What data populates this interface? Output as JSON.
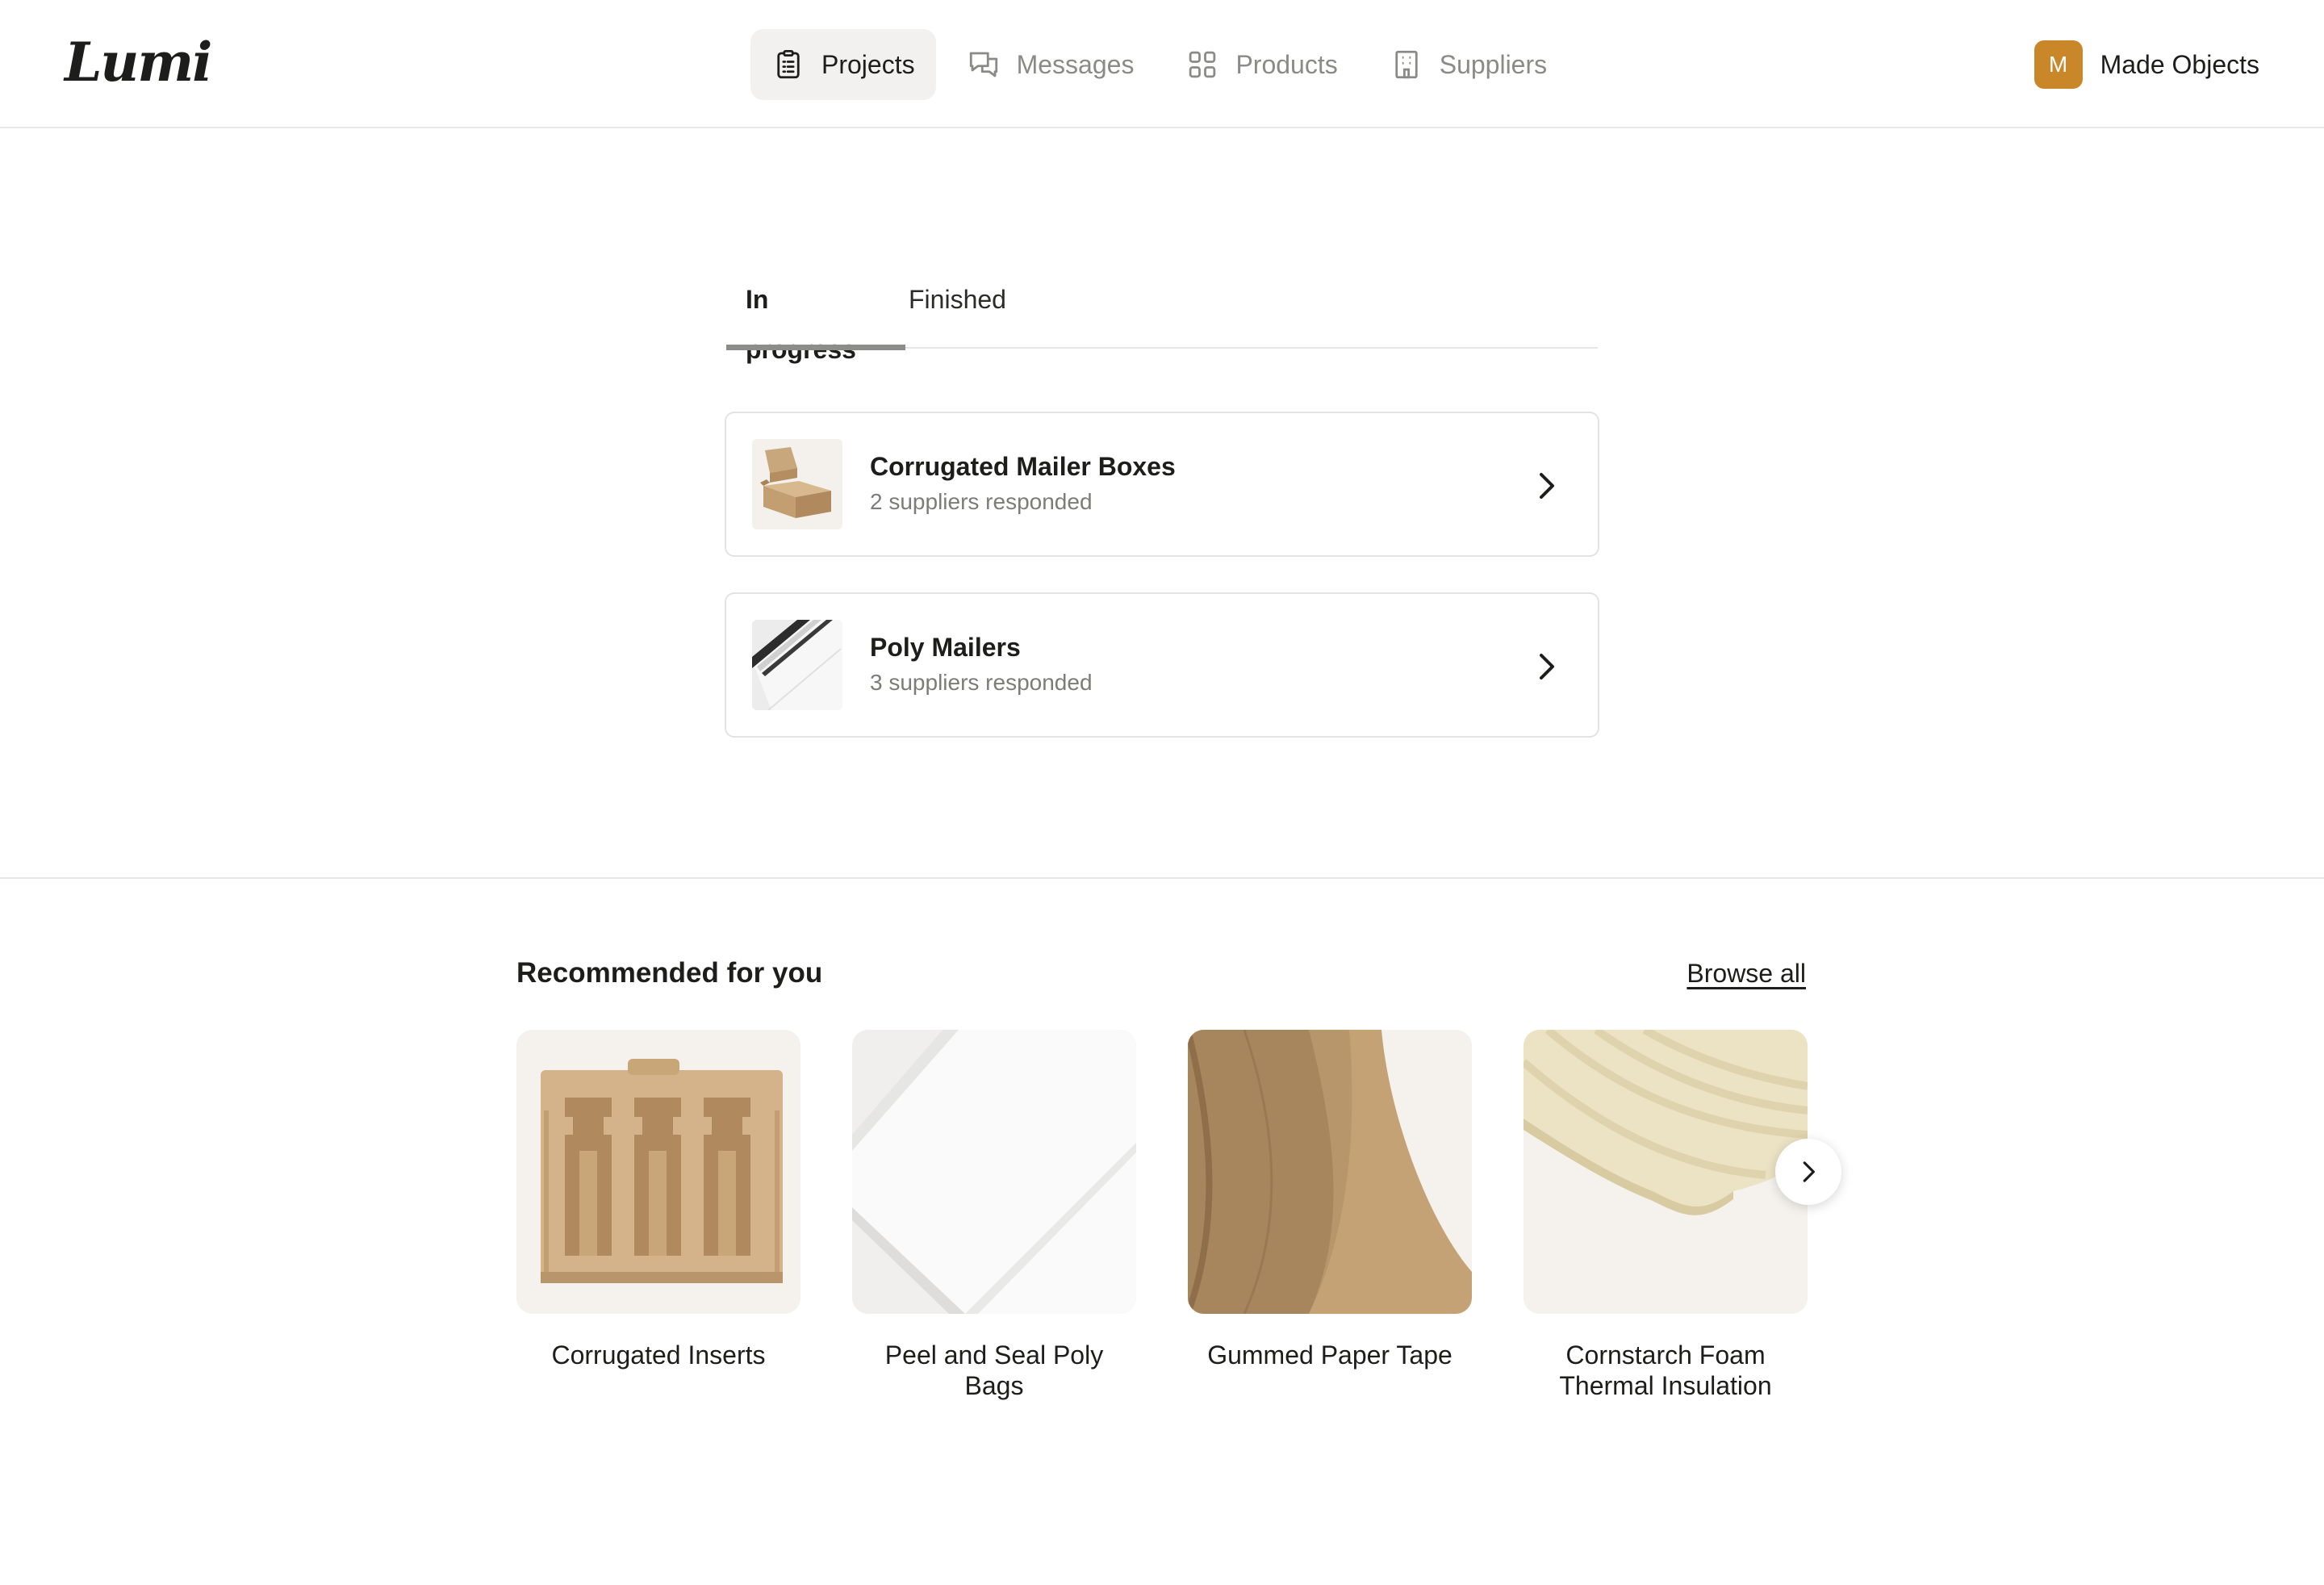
{
  "app": {
    "logo": "Lumi"
  },
  "nav": {
    "items": [
      {
        "label": "Projects",
        "icon": "clipboard-icon",
        "active": true
      },
      {
        "label": "Messages",
        "icon": "chat-icon",
        "active": false
      },
      {
        "label": "Products",
        "icon": "grid-icon",
        "active": false
      },
      {
        "label": "Suppliers",
        "icon": "building-icon",
        "active": false
      }
    ]
  },
  "account": {
    "initial": "M",
    "name": "Made Objects",
    "avatar_color": "#c9872a"
  },
  "tabs": [
    {
      "label": "In progress",
      "active": true
    },
    {
      "label": "Finished",
      "active": false
    }
  ],
  "projects": [
    {
      "title": "Corrugated Mailer Boxes",
      "subtitle": "2 suppliers responded",
      "thumb": "mailer-box"
    },
    {
      "title": "Poly Mailers",
      "subtitle": "3 suppliers responded",
      "thumb": "poly-mailer"
    }
  ],
  "recommended": {
    "title": "Recommended for you",
    "browse_label": "Browse all",
    "items": [
      {
        "label": "Corrugated Inserts"
      },
      {
        "label": "Peel and Seal Poly Bags"
      },
      {
        "label": "Gummed Paper Tape"
      },
      {
        "label": "Cornstarch Foam Thermal Insulation"
      }
    ]
  }
}
